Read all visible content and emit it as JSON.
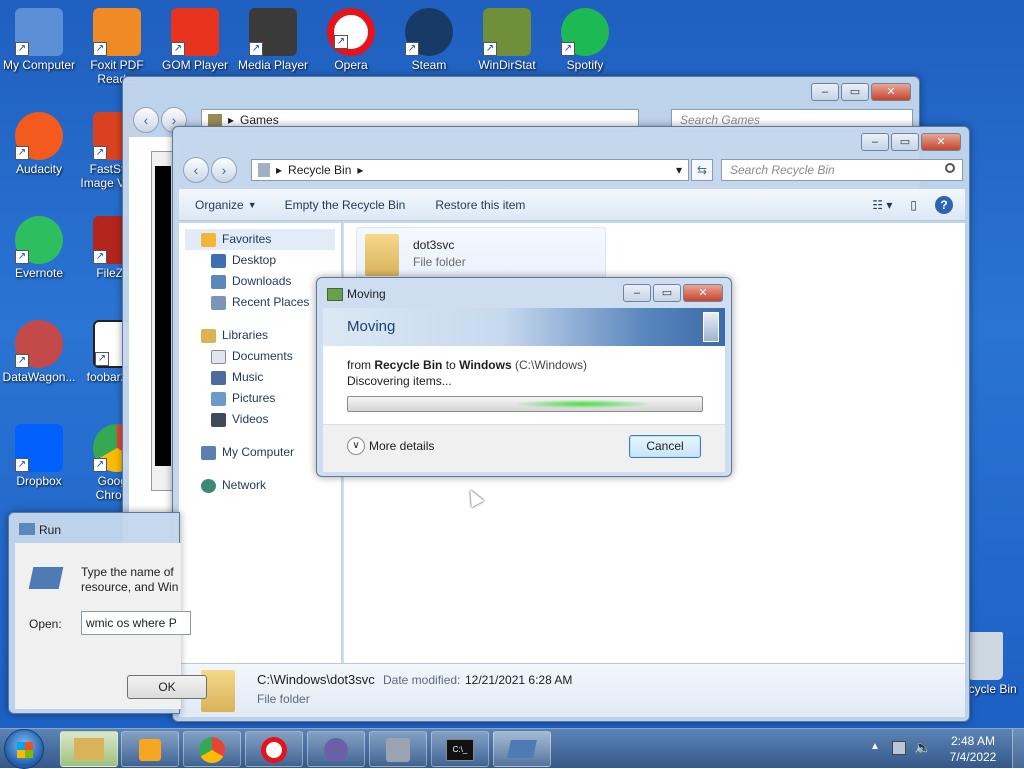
{
  "desktop_icons": [
    {
      "label": "My Computer",
      "icon": "computer-icon",
      "color": "#5b8fd6"
    },
    {
      "label": "Foxit PDF Reader",
      "icon": "foxit-pdf-icon",
      "color": "#f08a24"
    },
    {
      "label": "GOM Player",
      "icon": "gom-player-icon",
      "color": "#e8331f"
    },
    {
      "label": "Media Player",
      "icon": "media-player-icon",
      "color": "#3a3a3a"
    },
    {
      "label": "Opera",
      "icon": "opera-icon",
      "color": "#e5131b"
    },
    {
      "label": "Steam",
      "icon": "steam-icon",
      "color": "#173b66"
    },
    {
      "label": "WinDirStat",
      "icon": "windirstat-icon",
      "color": "#6f8f3a"
    },
    {
      "label": "Spotify",
      "icon": "spotify-icon",
      "color": "#1db954"
    },
    {
      "label": "Audacity",
      "icon": "audacity-icon",
      "color": "#f25b1d"
    },
    {
      "label": "FastStone Image Viewer",
      "icon": "faststone-icon",
      "color": "#d9411f"
    },
    {
      "label": "Evernote",
      "icon": "evernote-icon",
      "color": "#2dbe60"
    },
    {
      "label": "FileZilla",
      "icon": "filezilla-icon",
      "color": "#b3261e"
    },
    {
      "label": "DataWagon...",
      "icon": "datawagon-icon",
      "color": "#c44a4a"
    },
    {
      "label": "foobar2000",
      "icon": "foobar-icon",
      "color": "#222222"
    },
    {
      "label": "Dropbox",
      "icon": "dropbox-icon",
      "color": "#0061fe"
    },
    {
      "label": "Google Chrome",
      "icon": "chrome-icon",
      "color": "#34a853"
    },
    {
      "label": "Recycle Bin",
      "icon": "recycle-bin-icon",
      "color": "#cdd7e2"
    }
  ],
  "games_window": {
    "address": "Games",
    "search_placeholder": "Search Games"
  },
  "recycle_window": {
    "address": "Recycle Bin",
    "search_placeholder": "Search Recycle Bin",
    "toolbar": {
      "organize": "Organize",
      "empty": "Empty the Recycle Bin",
      "restore": "Restore this item"
    },
    "nav": {
      "favorites": "Favorites",
      "favorites_items": [
        "Desktop",
        "Downloads",
        "Recent Places"
      ],
      "libraries": "Libraries",
      "libraries_items": [
        "Documents",
        "Music",
        "Pictures",
        "Videos"
      ],
      "my_computer": "My Computer",
      "network": "Network"
    },
    "file": {
      "name": "dot3svc",
      "type": "File folder"
    },
    "details": {
      "path": "C:\\Windows\\dot3svc",
      "date_label": "Date modified:",
      "date_value": "12/21/2021 6:28 AM",
      "type": "File folder"
    }
  },
  "moving_dialog": {
    "title": "Moving",
    "header": "Moving",
    "from_word": "from",
    "source": "Recycle Bin",
    "to_word": "to",
    "dest": "Windows",
    "dest_path": "(C:\\Windows)",
    "status": "Discovering items...",
    "more_details": "More details",
    "cancel": "Cancel"
  },
  "run_dialog": {
    "title": "Run",
    "desc_line1": "Type the name of",
    "desc_line2": "resource, and Win",
    "open_label": "Open:",
    "open_value": "wmic os where P",
    "ok": "OK"
  },
  "taskbar": {
    "time": "2:48 AM",
    "date": "7/4/2022"
  }
}
